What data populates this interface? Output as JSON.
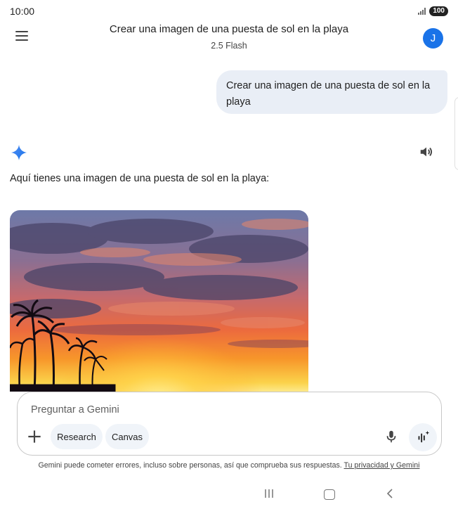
{
  "status_bar": {
    "time": "10:00",
    "battery": "100"
  },
  "header": {
    "title": "Crear una imagen de una puesta de sol en la playa",
    "model": "2.5 Flash",
    "avatar_initial": "J"
  },
  "conversation": {
    "user_message": "Crear una imagen de una puesta de sol en la playa",
    "response_text": "Aquí tienes una imagen de una puesta de sol en la playa:"
  },
  "input": {
    "placeholder": "Preguntar a Gemini",
    "chips": {
      "research": "Research",
      "canvas": "Canvas"
    }
  },
  "footer": {
    "disclaimer": "Gemini puede cometer errores, incluso sobre personas, así que comprueba sus respuestas.",
    "privacy_link": "Tu privacidad y Gemini"
  },
  "icons": {
    "menu": "menu-icon",
    "spark": "gemini-spark-icon",
    "speaker": "speaker-icon",
    "plus": "plus-icon",
    "mic": "microphone-icon",
    "live": "live-audio-icon"
  },
  "colors": {
    "accent": "#1a73e8",
    "bubble": "#e9eef6",
    "chip": "#f0f4f9"
  }
}
